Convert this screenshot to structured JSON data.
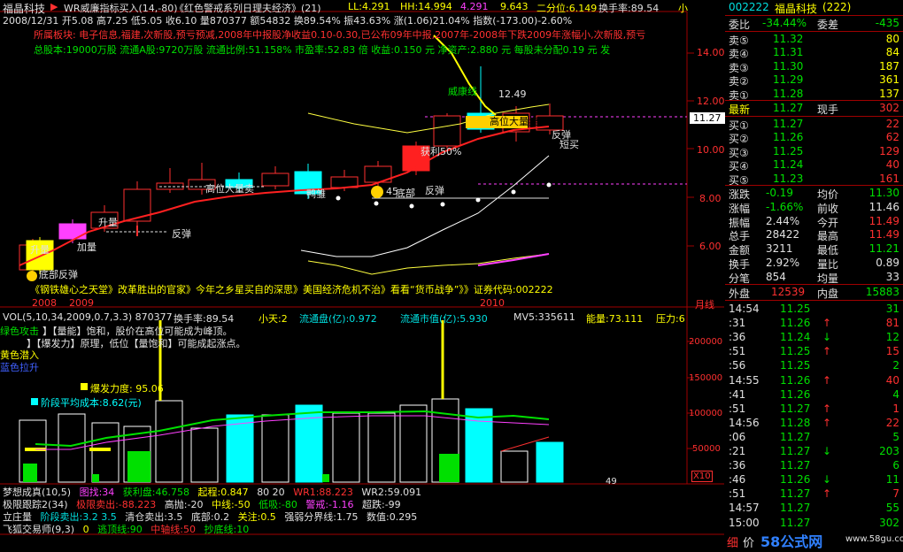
{
  "header": {
    "app_name": "福晶科技",
    "indicator": "WR威廉指标买入(14,-80)",
    "headline": "《红色警戒系列日理夫经济》(21)",
    "ll": "LL:4.291",
    "hh": "HH:14.994",
    "v1": "4.291",
    "v2": "9.643",
    "erfen": "二分位:6.149",
    "huanshou": "换手率:89.54",
    "xiao": "小",
    "bar_info": "2008/12/31 开5.08 高7.25 低5.05 收6.10 量870377 额54832 换89.54% 振43.63% 涨(1.06)21.04% 指数(-173.00)-2.60%",
    "news": "所属板块: 电子信息,福建,次新股,预亏预减,2008年中报股净收益0.10-0.30,已公布09年中报,2007年-2008年下跌2009年涨幅小,次新股,预亏",
    "stock_info": "总股本:19000万股  流通A股:9720万股  流通比例:51.158%  市盈率:52.83 倍  收益:0.150 元  净资产:2.880 元  每股未分配0.19 元  发"
  },
  "price_axis": [
    "14.00",
    "12.00",
    "10.00",
    "8.00",
    "6.00"
  ],
  "current_price_tag": "11.27",
  "chart_labels": {
    "weikang": "威康线",
    "top_value": "12.49",
    "gaowei": "高位大量卖",
    "fantan1": "反弹",
    "duanmai": "短买",
    "huoli": "获利50%",
    "gaoweidaliang": "高位大量卖",
    "yashang": "鸭雏",
    "dibu": "底部",
    "fantan2": "反弹",
    "num45": "45",
    "shengliang1": "升量",
    "shengliang2": "升量",
    "fantan3": "反弹",
    "jialiang": "加量",
    "dibufantan": "底部反弹",
    "ticker_line": "《钢铁雄心之天堂》改革胜出的官家》今年之乡星买自的深思》美国经济危机不治》看看“货币战争”》》证券代码:002222"
  },
  "date_axis": [
    "2008",
    "2009",
    "2010"
  ],
  "tab_label": "月线",
  "volume": {
    "header": "VOL(5,10,34,2009,0.7,3.3) 870377",
    "huanshou": "换手率:89.54",
    "xiaotian": "小天:2",
    "liutongpan": "流通盘(亿):0.972",
    "liutongshizhi": "流通市值(亿):5.930",
    "mv5": "MV5:335611",
    "nengliang": "能量:73.111",
    "yali": "压力:6",
    "lvse": "绿色攻击",
    "line1": "】【量能】饱和，股价在高位可能成为峰顶。",
    "line2": "】【爆发力】原理，低位【量饱和】可能成起涨点。",
    "huangse": "黄色潜入",
    "lanse": "蓝色拉升",
    "baofa": "爆发力度: 95.06",
    "jieduan": "阶段平均成本:8.62(元)",
    "ticks": [
      "200000",
      "150000",
      "100000",
      "50000"
    ],
    "corner": "X10",
    "bottom_num": "49"
  },
  "indicators": {
    "r1": [
      "梦想成真(10,5)",
      "图找:34",
      "获利盘:46.758",
      "起程:0.847",
      "80 20",
      "WR1:88.223",
      "WR2:59.091"
    ],
    "r2": [
      "极限跟踪2(34)",
      "极限卖出:-88.223",
      "高抛:-20",
      "中线:-50",
      "低吸:-80",
      "警戒:-1.16",
      "超跌:-99"
    ],
    "r3": [
      "立庄量",
      "阶段卖出:3.2 3.5",
      "清仓卖出:3.5",
      "底部:0.2",
      "关注:0.5",
      "强弱分界线:1.75",
      "数值:0.295"
    ],
    "r4": [
      "飞狐交易师(9,3)",
      "0",
      "逃顶线:90",
      "中轴线:50",
      "抄底线:10"
    ]
  },
  "panel": {
    "code": "002222",
    "name": "福晶科技",
    "count": "(222)",
    "weibi_label": "委比",
    "weibi_val": "-34.44%",
    "weicha_label": "委差",
    "weicha_val": "-435",
    "sells": [
      {
        "label": "卖⑤",
        "price": "11.32",
        "vol": "80"
      },
      {
        "label": "卖④",
        "price": "11.31",
        "vol": "84"
      },
      {
        "label": "卖③",
        "price": "11.30",
        "vol": "187"
      },
      {
        "label": "卖②",
        "price": "11.29",
        "vol": "361"
      },
      {
        "label": "卖①",
        "price": "11.28",
        "vol": "137"
      }
    ],
    "latest_label": "最新",
    "latest_val": "11.27",
    "xianshou_label": "现手",
    "xianshou_val": "302",
    "buys": [
      {
        "label": "买①",
        "price": "11.27",
        "vol": "22"
      },
      {
        "label": "买②",
        "price": "11.26",
        "vol": "62"
      },
      {
        "label": "买③",
        "price": "11.25",
        "vol": "129"
      },
      {
        "label": "买④",
        "price": "11.24",
        "vol": "40"
      },
      {
        "label": "买⑤",
        "price": "11.23",
        "vol": "161"
      }
    ],
    "stats": [
      {
        "l1": "涨跌",
        "v1": "-0.19",
        "c1": "#00e000",
        "l2": "均价",
        "v2": "11.30",
        "c2": "#00e000"
      },
      {
        "l1": "涨幅",
        "v1": "-1.66%",
        "c1": "#00e000",
        "l2": "前收",
        "v2": "11.46",
        "c2": "#e0e0e0"
      },
      {
        "l1": "振幅",
        "v1": "2.44%",
        "c1": "#e0e0e0",
        "l2": "今开",
        "v2": "11.49",
        "c2": "#ff3030"
      },
      {
        "l1": "总手",
        "v1": "28422",
        "c1": "#e0e0e0",
        "l2": "最高",
        "v2": "11.49",
        "c2": "#ff3030"
      },
      {
        "l1": "金额",
        "v1": "3211",
        "c1": "#e0e0e0",
        "l2": "最低",
        "v2": "11.21",
        "c2": "#00e000"
      },
      {
        "l1": "换手",
        "v1": "2.92%",
        "c1": "#e0e0e0",
        "l2": "量比",
        "v2": "0.89",
        "c2": "#e0e0e0"
      },
      {
        "l1": "分笔",
        "v1": "854",
        "c1": "#e0e0e0",
        "l2": "均量",
        "v2": "33",
        "c2": "#e0e0e0"
      }
    ],
    "waipan_label": "外盘",
    "waipan_val": "12539",
    "neipan_label": "内盘",
    "neipan_val": "15883",
    "ticks": [
      {
        "t": "14:54",
        "p": "11.25",
        "pc": "#00e000",
        "a": "",
        "ac": "",
        "v": "31",
        "vc": "#00e000"
      },
      {
        "t": ":31",
        "p": "11.26",
        "pc": "#00e000",
        "a": "↑",
        "ac": "#ff3030",
        "v": "81",
        "vc": "#ff3030"
      },
      {
        "t": ":36",
        "p": "11.24",
        "pc": "#00e000",
        "a": "↓",
        "ac": "#00e000",
        "v": "12",
        "vc": "#00e000"
      },
      {
        "t": ":51",
        "p": "11.25",
        "pc": "#00e000",
        "a": "↑",
        "ac": "#ff3030",
        "v": "15",
        "vc": "#ff3030"
      },
      {
        "t": ":56",
        "p": "11.25",
        "pc": "#00e000",
        "a": "",
        "ac": "",
        "v": "2",
        "vc": "#00e000"
      },
      {
        "t": "14:55",
        "p": "11.26",
        "pc": "#00e000",
        "a": "↑",
        "ac": "#ff3030",
        "v": "40",
        "vc": "#ff3030"
      },
      {
        "t": ":41",
        "p": "11.26",
        "pc": "#00e000",
        "a": "",
        "ac": "",
        "v": "4",
        "vc": "#00e000"
      },
      {
        "t": ":51",
        "p": "11.27",
        "pc": "#00e000",
        "a": "↑",
        "ac": "#ff3030",
        "v": "1",
        "vc": "#ff3030"
      },
      {
        "t": "14:56",
        "p": "11.28",
        "pc": "#00e000",
        "a": "↑",
        "ac": "#ff3030",
        "v": "22",
        "vc": "#ff3030"
      },
      {
        "t": ":06",
        "p": "11.27",
        "pc": "#00e000",
        "a": "",
        "ac": "",
        "v": "5",
        "vc": "#00e000"
      },
      {
        "t": ":21",
        "p": "11.27",
        "pc": "#00e000",
        "a": "↓",
        "ac": "#00e000",
        "v": "203",
        "vc": "#00e000"
      },
      {
        "t": ":36",
        "p": "11.27",
        "pc": "#00e000",
        "a": "",
        "ac": "",
        "v": "6",
        "vc": "#00e000"
      },
      {
        "t": ":46",
        "p": "11.26",
        "pc": "#00e000",
        "a": "↓",
        "ac": "#00e000",
        "v": "11",
        "vc": "#00e000"
      },
      {
        "t": ":51",
        "p": "11.27",
        "pc": "#00e000",
        "a": "↑",
        "ac": "#ff3030",
        "v": "7",
        "vc": "#ff3030"
      },
      {
        "t": "14:57",
        "p": "11.27",
        "pc": "#00e000",
        "a": "",
        "ac": "",
        "v": "55",
        "vc": "#00e000"
      },
      {
        "t": "15:00",
        "p": "11.27",
        "pc": "#00e000",
        "a": "",
        "ac": "",
        "v": "302",
        "vc": "#00e000"
      }
    ],
    "footer_left": "细",
    "footer_mid": "价",
    "watermark": "58公式网",
    "watermark_url": "www.58gu.com"
  }
}
